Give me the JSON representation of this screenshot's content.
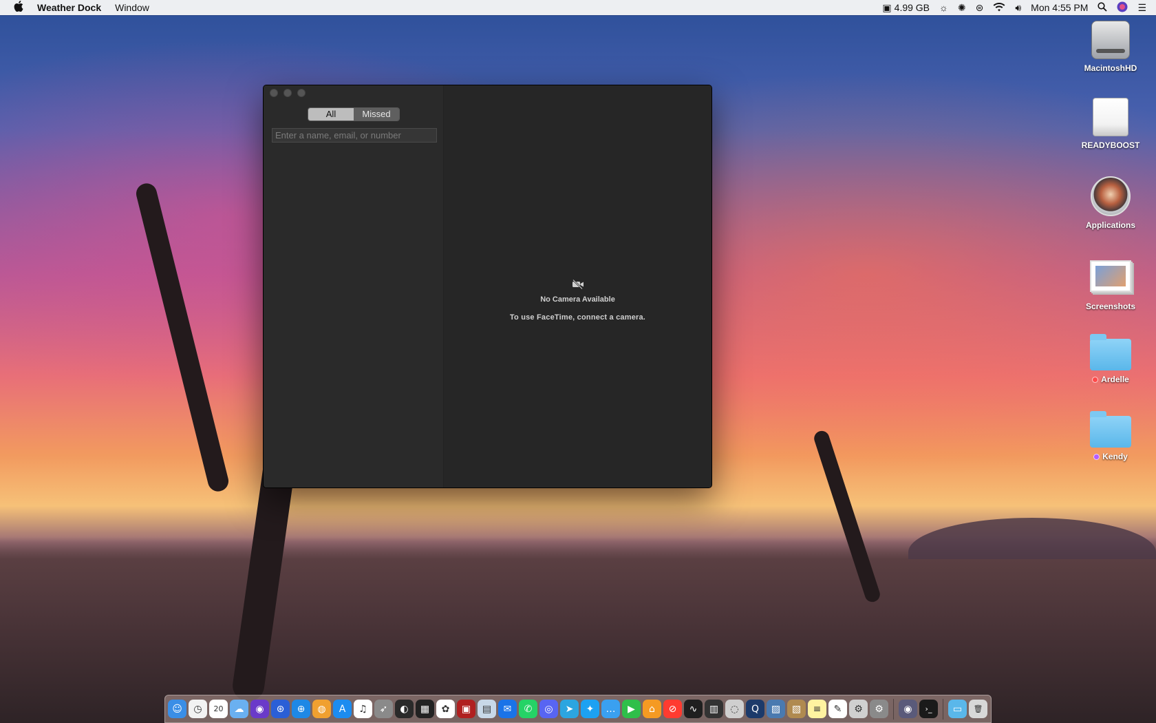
{
  "menubar": {
    "app_name": "Weather Dock",
    "menus": [
      "Window"
    ],
    "memory": "4.99 GB",
    "clock": "Mon 4:55 PM"
  },
  "desktop_icons": [
    {
      "label": "MacintoshHD",
      "icon": "hard-drive-icon"
    },
    {
      "label": "READYBOOST",
      "icon": "usb-drive-icon"
    },
    {
      "label": "Applications",
      "icon": "applications-folder-icon"
    },
    {
      "label": "Screenshots",
      "icon": "screenshots-folder-icon"
    },
    {
      "label": "Ardelle",
      "icon": "folder-icon",
      "tag_color": "#ff4a4a"
    },
    {
      "label": "Kendy",
      "icon": "folder-icon",
      "tag_color": "#b45cff"
    }
  ],
  "facetime": {
    "tabs": [
      "All",
      "Missed"
    ],
    "active_tab": "All",
    "search_placeholder": "Enter a name, email, or number",
    "no_camera_title": "No Camera Available",
    "no_camera_subtitle": "To use FaceTime, connect a camera."
  },
  "dock": {
    "calendar_day": "20",
    "items": [
      {
        "name": "finder-icon",
        "color": "#3a8ee6",
        "glyph": "☺"
      },
      {
        "name": "clock-icon",
        "color": "#f2f2f2",
        "glyph": "◷"
      },
      {
        "name": "calendar-icon",
        "color": "#ffffff",
        "glyph": "20"
      },
      {
        "name": "weather-dock-icon",
        "color": "#6ab0f0",
        "glyph": "☁"
      },
      {
        "name": "siri-icon",
        "color": "#6a3ac9",
        "glyph": "◉"
      },
      {
        "name": "launchpad-icon",
        "color": "#2a5fd6",
        "glyph": "⊛"
      },
      {
        "name": "safari-icon",
        "color": "#1e88e5",
        "glyph": "⊕"
      },
      {
        "name": "can-icon",
        "color": "#f0a030",
        "glyph": "◍"
      },
      {
        "name": "app-store-icon",
        "color": "#1c8cf0",
        "glyph": "A"
      },
      {
        "name": "itunes-icon",
        "color": "#ffffff",
        "glyph": "♫"
      },
      {
        "name": "rocket-icon",
        "color": "#8a8a8a",
        "glyph": "➶"
      },
      {
        "name": "dashboard-icon",
        "color": "#2a2a2a",
        "glyph": "◐"
      },
      {
        "name": "mission-control-icon",
        "color": "#222222",
        "glyph": "▦"
      },
      {
        "name": "photos-icon",
        "color": "#ffffff",
        "glyph": "✿"
      },
      {
        "name": "photo-booth-icon",
        "color": "#b02020",
        "glyph": "▣"
      },
      {
        "name": "preview-icon",
        "color": "#c8d8e8",
        "glyph": "▤"
      },
      {
        "name": "messenger-icon",
        "color": "#1a73e8",
        "glyph": "✉"
      },
      {
        "name": "whatsapp-icon",
        "color": "#25d366",
        "glyph": "✆"
      },
      {
        "name": "discord-icon",
        "color": "#5865f2",
        "glyph": "◎"
      },
      {
        "name": "telegram-icon",
        "color": "#2ca5e0",
        "glyph": "➤"
      },
      {
        "name": "twitter-icon",
        "color": "#1da1f2",
        "glyph": "✦"
      },
      {
        "name": "messages-icon",
        "color": "#3aa0f0",
        "glyph": "…"
      },
      {
        "name": "facetime-icon",
        "color": "#2fbf4a",
        "glyph": "▶"
      },
      {
        "name": "home-icon",
        "color": "#f59a23",
        "glyph": "⌂"
      },
      {
        "name": "news-icon",
        "color": "#ff3b30",
        "glyph": "⊘"
      },
      {
        "name": "activity-monitor-icon",
        "color": "#1f1f1f",
        "glyph": "∿"
      },
      {
        "name": "istat-icon",
        "color": "#333333",
        "glyph": "▥"
      },
      {
        "name": "disk-utility-icon",
        "color": "#cfcfcf",
        "glyph": "◌"
      },
      {
        "name": "quicktime-icon",
        "color": "#1c3a6a",
        "glyph": "Q"
      },
      {
        "name": "image-capture-icon",
        "color": "#4a7ab0",
        "glyph": "▨"
      },
      {
        "name": "notefile-icon",
        "color": "#b08a50",
        "glyph": "▧"
      },
      {
        "name": "notes-icon",
        "color": "#fff3a0",
        "glyph": "≡"
      },
      {
        "name": "textedit-icon",
        "color": "#ffffff",
        "glyph": "✎"
      },
      {
        "name": "script-editor-icon",
        "color": "#d0d0d0",
        "glyph": "⚙"
      },
      {
        "name": "system-preferences-icon",
        "color": "#8a8a8a",
        "glyph": "⚙"
      },
      {
        "name": "separator"
      },
      {
        "name": "screenshot-app-icon",
        "color": "#5a5a7a",
        "glyph": "◉"
      },
      {
        "name": "terminal-icon",
        "color": "#1a1a1a",
        "glyph": "›_"
      },
      {
        "name": "separator"
      },
      {
        "name": "downloads-folder-icon",
        "color": "#5ab7ea",
        "glyph": "▭"
      },
      {
        "name": "trash-icon",
        "color": "#d8d8d8",
        "glyph": "🗑"
      }
    ]
  }
}
